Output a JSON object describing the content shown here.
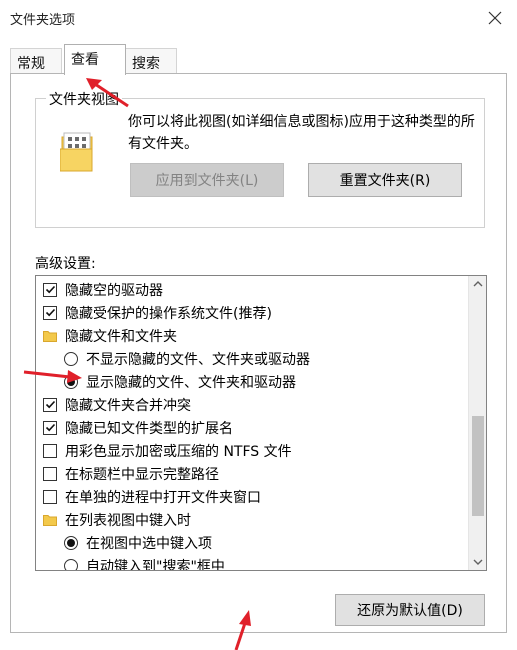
{
  "window": {
    "title": "文件夹选项"
  },
  "tabs": [
    {
      "label": "常规"
    },
    {
      "label": "查看"
    },
    {
      "label": "搜索"
    }
  ],
  "folder_views": {
    "group_label": "文件夹视图",
    "description": "你可以将此视图(如详细信息或图标)应用于这种类型的所有文件夹。",
    "apply_label": "应用到文件夹(L)",
    "reset_label": "重置文件夹(R)"
  },
  "advanced": {
    "label": "高级设置:",
    "items": [
      {
        "type": "checkbox",
        "checked": true,
        "label": "隐藏空的驱动器"
      },
      {
        "type": "checkbox",
        "checked": true,
        "label": "隐藏受保护的操作系统文件(推荐)"
      },
      {
        "type": "folder",
        "label": "隐藏文件和文件夹"
      },
      {
        "type": "radio",
        "checked": false,
        "label": "不显示隐藏的文件、文件夹或驱动器"
      },
      {
        "type": "radio",
        "checked": true,
        "label": "显示隐藏的文件、文件夹和驱动器"
      },
      {
        "type": "checkbox",
        "checked": true,
        "label": "隐藏文件夹合并冲突"
      },
      {
        "type": "checkbox",
        "checked": true,
        "label": "隐藏已知文件类型的扩展名"
      },
      {
        "type": "checkbox",
        "checked": false,
        "label": "用彩色显示加密或压缩的 NTFS 文件"
      },
      {
        "type": "checkbox",
        "checked": false,
        "label": "在标题栏中显示完整路径"
      },
      {
        "type": "checkbox",
        "checked": false,
        "label": "在单独的进程中打开文件夹窗口"
      },
      {
        "type": "folder",
        "label": "在列表视图中键入时"
      },
      {
        "type": "radio",
        "checked": true,
        "label": "在视图中选中键入项"
      },
      {
        "type": "radio",
        "checked": false,
        "label": "自动键入到\"搜索\"框中"
      }
    ]
  },
  "restore_label": "还原为默认值(D)",
  "colors": {
    "annotation_arrow": "#e0202a",
    "folder": "#f3c94b"
  }
}
